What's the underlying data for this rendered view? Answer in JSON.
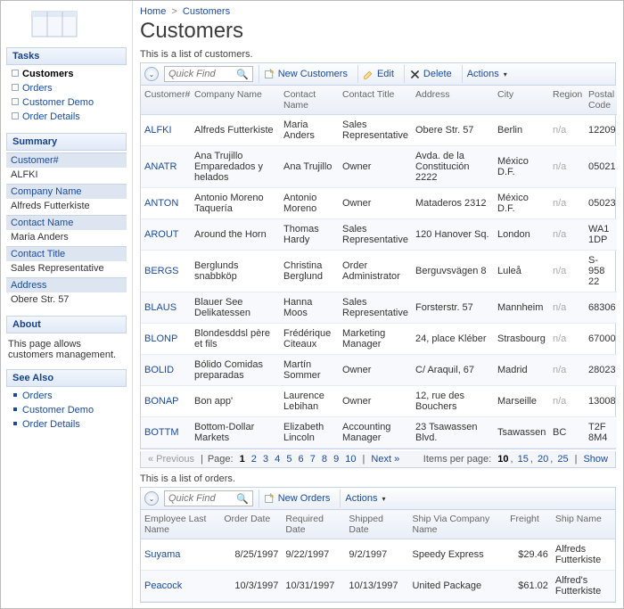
{
  "breadcrumb": {
    "home": "Home",
    "current": "Customers"
  },
  "page_title": "Customers",
  "sidebar": {
    "tasks_title": "Tasks",
    "tasks": [
      {
        "label": "Customers",
        "current": true
      },
      {
        "label": "Orders"
      },
      {
        "label": "Customer Demo"
      },
      {
        "label": "Order Details"
      }
    ],
    "summary_title": "Summary",
    "summary": [
      {
        "label": "Customer#",
        "value": "ALFKI"
      },
      {
        "label": "Company Name",
        "value": "Alfreds Futterkiste"
      },
      {
        "label": "Contact Name",
        "value": "Maria Anders"
      },
      {
        "label": "Contact Title",
        "value": "Sales Representative"
      },
      {
        "label": "Address",
        "value": "Obere Str. 57"
      }
    ],
    "about_title": "About",
    "about_text": "This page allows customers management.",
    "seealso_title": "See Also",
    "seealso": [
      {
        "label": "Orders"
      },
      {
        "label": "Customer Demo"
      },
      {
        "label": "Order Details"
      }
    ]
  },
  "customers": {
    "desc": "This is a list of customers.",
    "quickfind_placeholder": "Quick Find",
    "btn_new": "New Customers",
    "btn_edit": "Edit",
    "btn_delete": "Delete",
    "btn_actions": "Actions",
    "columns": [
      "Customer#",
      "Company Name",
      "Contact Name",
      "Contact Title",
      "Address",
      "City",
      "Region",
      "Postal Code"
    ],
    "rows": [
      {
        "id": "ALFKI",
        "company": "Alfreds Futterkiste",
        "contact": "Maria Anders",
        "title": "Sales Representative",
        "address": "Obere Str. 57",
        "city": "Berlin",
        "region": "n/a",
        "postal": "12209"
      },
      {
        "id": "ANATR",
        "company": "Ana Trujillo Emparedados y helados",
        "contact": "Ana Trujillo",
        "title": "Owner",
        "address": "Avda. de la Constitución 2222",
        "city": "México D.F.",
        "region": "n/a",
        "postal": "05021"
      },
      {
        "id": "ANTON",
        "company": "Antonio Moreno Taquería",
        "contact": "Antonio Moreno",
        "title": "Owner",
        "address": "Mataderos 2312",
        "city": "México D.F.",
        "region": "n/a",
        "postal": "05023"
      },
      {
        "id": "AROUT",
        "company": "Around the Horn",
        "contact": "Thomas Hardy",
        "title": "Sales Representative",
        "address": "120 Hanover Sq.",
        "city": "London",
        "region": "n/a",
        "postal": "WA1 1DP"
      },
      {
        "id": "BERGS",
        "company": "Berglunds snabbköp",
        "contact": "Christina Berglund",
        "title": "Order Administrator",
        "address": "Berguvsvägen 8",
        "city": "Luleå",
        "region": "n/a",
        "postal": "S-958 22"
      },
      {
        "id": "BLAUS",
        "company": "Blauer See Delikatessen",
        "contact": "Hanna Moos",
        "title": "Sales Representative",
        "address": "Forsterstr. 57",
        "city": "Mannheim",
        "region": "n/a",
        "postal": "68306"
      },
      {
        "id": "BLONP",
        "company": "Blondesddsl père et fils",
        "contact": "Frédérique Citeaux",
        "title": "Marketing Manager",
        "address": "24, place Kléber",
        "city": "Strasbourg",
        "region": "n/a",
        "postal": "67000"
      },
      {
        "id": "BOLID",
        "company": "Bólido Comidas preparadas",
        "contact": "Martín Sommer",
        "title": "Owner",
        "address": "C/ Araquil, 67",
        "city": "Madrid",
        "region": "n/a",
        "postal": "28023"
      },
      {
        "id": "BONAP",
        "company": "Bon app'",
        "contact": "Laurence Lebihan",
        "title": "Owner",
        "address": "12, rue des Bouchers",
        "city": "Marseille",
        "region": "n/a",
        "postal": "13008"
      },
      {
        "id": "BOTTM",
        "company": "Bottom-Dollar Markets",
        "contact": "Elizabeth Lincoln",
        "title": "Accounting Manager",
        "address": "23 Tsawassen Blvd.",
        "city": "Tsawassen",
        "region": "BC",
        "postal": "T2F 8M4"
      }
    ],
    "pager": {
      "prev": "« Previous",
      "page_label": "Page:",
      "pages": [
        "1",
        "2",
        "3",
        "4",
        "5",
        "6",
        "7",
        "8",
        "9",
        "10"
      ],
      "current_page": "1",
      "next": "Next »",
      "ipp_label": "Items per page:",
      "ipp_options": [
        "10",
        "15",
        "20",
        "25"
      ],
      "ipp_current": "10",
      "show_label": "Show"
    }
  },
  "orders": {
    "desc": "This is a list of orders.",
    "quickfind_placeholder": "Quick Find",
    "btn_new": "New Orders",
    "btn_actions": "Actions",
    "columns": [
      "Employee Last Name",
      "Order Date",
      "Required Date",
      "Shipped Date",
      "Ship Via Company Name",
      "Freight",
      "Ship Name"
    ],
    "rows": [
      {
        "emp": "Suyama",
        "order": "8/25/1997",
        "required": "9/22/1997",
        "shipped": "9/2/1997",
        "shipvia": "Speedy Express",
        "freight": "$29.46",
        "shipname": "Alfreds Futterkiste"
      },
      {
        "emp": "Peacock",
        "order": "10/3/1997",
        "required": "10/31/1997",
        "shipped": "10/13/1997",
        "shipvia": "United Package",
        "freight": "$61.02",
        "shipname": "Alfred's Futterkiste"
      }
    ]
  }
}
